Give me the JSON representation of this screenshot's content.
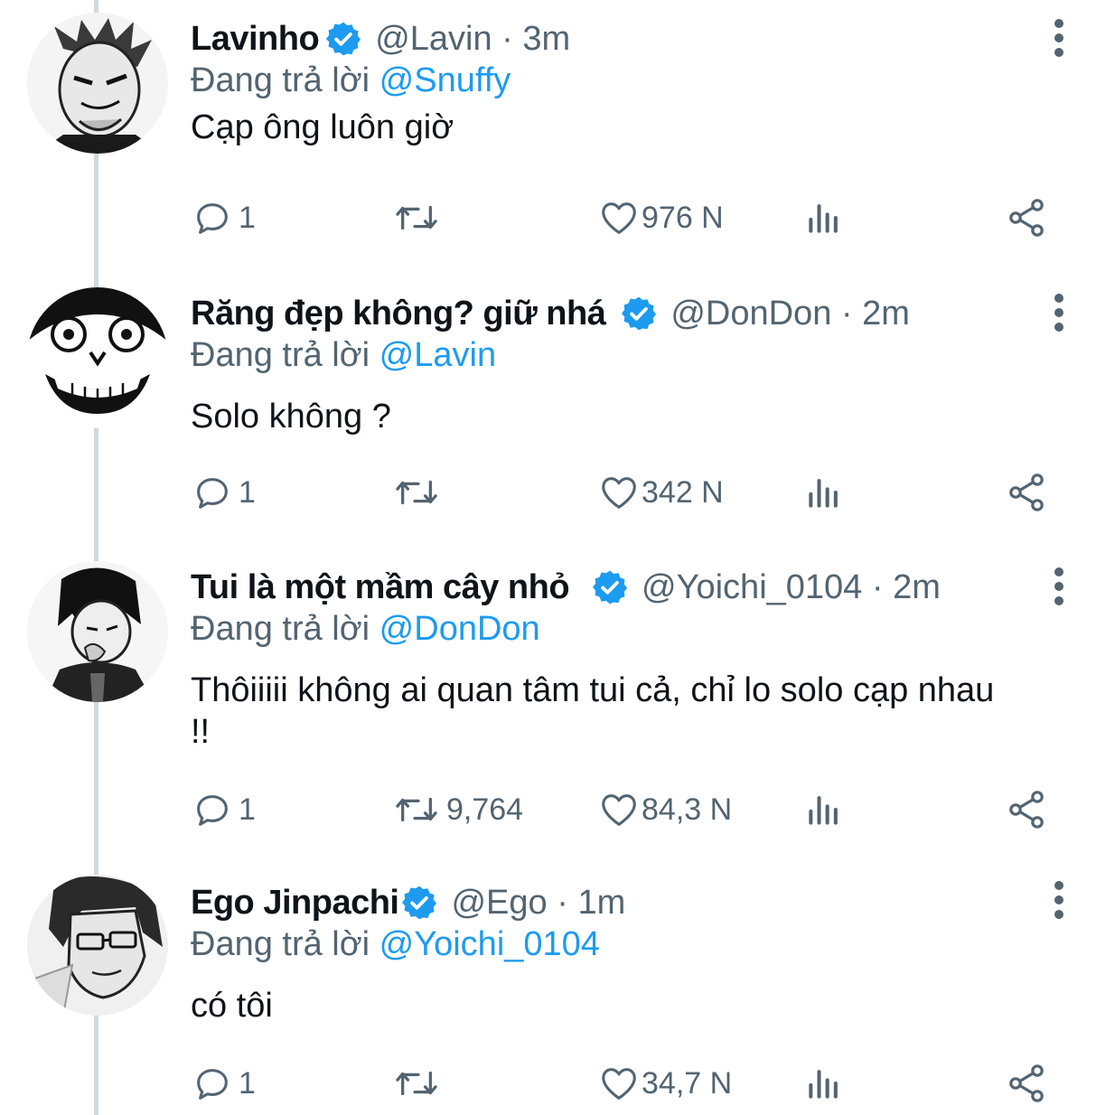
{
  "tweets": [
    {
      "name": "Lavinho",
      "handle_time": "@Lavin · 3m",
      "replying_label": "Đang trả lời",
      "replying_to": "@Snuffy",
      "text": "Cạp ông luôn giờ",
      "replies": "1",
      "retweets": "",
      "likes": "976 N"
    },
    {
      "name": "Răng đẹp không? giữ nhá",
      "handle_time": "@DonDon · 2m",
      "replying_label": "Đang trả lời",
      "replying_to": "@Lavin",
      "text": "Solo không ?",
      "replies": "1",
      "retweets": "",
      "likes": "342 N"
    },
    {
      "name": "Tui là một mầm cây nhỏ",
      "handle_time": "@Yoichi_0104 · 2m",
      "replying_label": "Đang trả lời",
      "replying_to": "@DonDon",
      "text": "Thôiiiii không ai quan tâm tui cả, chỉ lo solo cạp nhau !!",
      "replies": "1",
      "retweets": "9,764",
      "likes": "84,3 N"
    },
    {
      "name": "Ego Jinpachi",
      "handle_time": "@Ego · 1m",
      "replying_label": "Đang trả lời",
      "replying_to": "@Yoichi_0104",
      "text": "có tôi",
      "replies": "1",
      "retweets": "",
      "likes": "34,7 N"
    }
  ],
  "icons": {
    "verified": "verified-badge-icon",
    "more": "more-vertical-icon",
    "reply": "reply-bubble-icon",
    "retweet": "retweet-icon",
    "like": "heart-icon",
    "views": "bar-chart-icon",
    "share": "share-icon"
  },
  "colors": {
    "accent": "#1d9bf0",
    "muted": "#536471",
    "text": "#0f1419",
    "thread_line": "#cfd9de"
  }
}
